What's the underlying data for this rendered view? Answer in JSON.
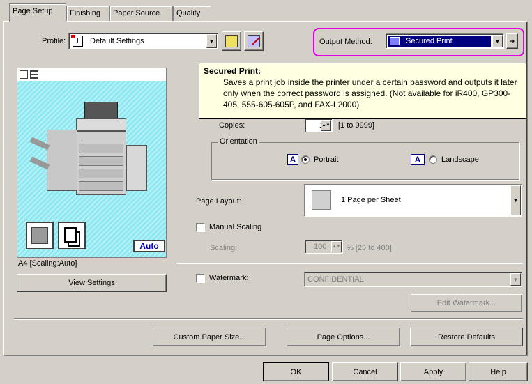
{
  "tabs": [
    {
      "label": "Page Setup",
      "active": true
    },
    {
      "label": "Finishing"
    },
    {
      "label": "Paper Source"
    },
    {
      "label": "Quality"
    }
  ],
  "profile": {
    "label": "Profile:",
    "value": "Default Settings"
  },
  "output_method": {
    "label": "Output Method:",
    "value": "Secured Print"
  },
  "tooltip": {
    "title": "Secured Print:",
    "body": "Saves a print job inside the printer under a certain password and outputs it later only when the correct password is assigned. (Not available for iR400, GP300-405, 555-605-605P, and FAX-L2000)"
  },
  "preview": {
    "badge": "Auto",
    "caption": "A4 [Scaling:Auto]",
    "view_settings": "View Settings"
  },
  "copies": {
    "label": "Copies:",
    "value": "1",
    "range": "[1 to 9999]"
  },
  "orientation": {
    "label": "Orientation",
    "portrait": "Portrait",
    "landscape": "Landscape",
    "icon_letter": "A"
  },
  "page_layout": {
    "label": "Page Layout:",
    "value": "1 Page per Sheet"
  },
  "manual_scaling": {
    "label": "Manual Scaling"
  },
  "scaling": {
    "label": "Scaling:",
    "value": "100",
    "range": "% [25 to 400]"
  },
  "watermark": {
    "label": "Watermark:",
    "value": "CONFIDENTIAL",
    "edit": "Edit Watermark..."
  },
  "buttons": {
    "custom_paper": "Custom Paper Size...",
    "page_options": "Page Options...",
    "restore": "Restore Defaults",
    "ok": "OK",
    "cancel": "Cancel",
    "apply": "Apply",
    "help": "Help"
  },
  "colors": {
    "accent": "#000080",
    "highlight_outline": "#e000e0",
    "tooltip_bg": "#ffffe1",
    "preview_bg": "#8fe8f0"
  }
}
